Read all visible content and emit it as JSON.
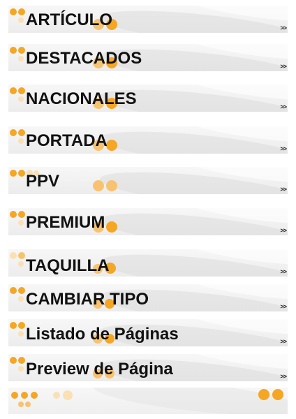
{
  "menu": {
    "items": [
      {
        "label": "ARTÍCULO"
      },
      {
        "label": "DESTACADOS"
      },
      {
        "label": "NACIONALES"
      },
      {
        "label": "PORTADA"
      },
      {
        "label": "PPV"
      },
      {
        "label": "PREMIUM"
      },
      {
        "label": "TAQUILLA"
      },
      {
        "label": "CAMBIAR TIPO"
      },
      {
        "label": "Listado de Páginas"
      },
      {
        "label": "Preview de Página"
      }
    ],
    "arrow": ">>"
  },
  "colors": {
    "accent_dot": "#f5a623",
    "background_band": "#efefef",
    "text": "#111111"
  }
}
